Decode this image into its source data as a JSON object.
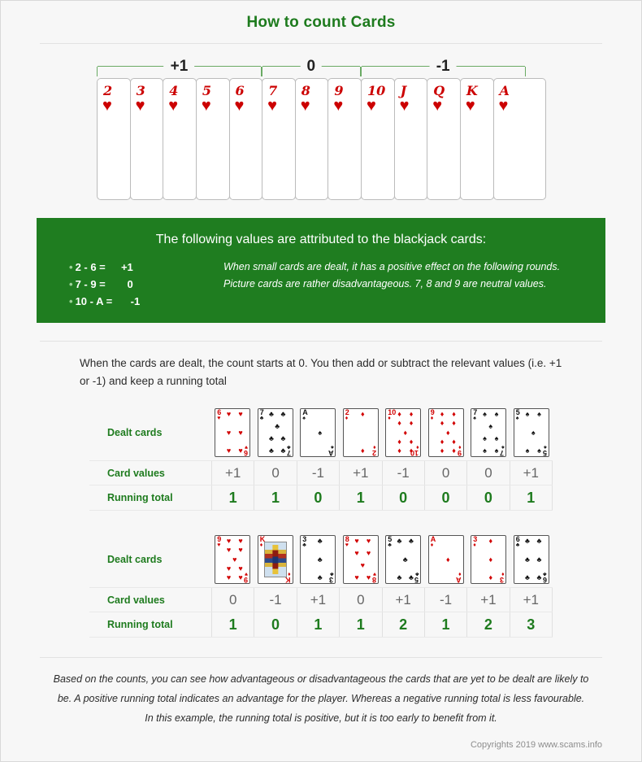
{
  "page": {
    "title": "How to count Cards",
    "copyright": "Copyrights 2019 www.scams.info",
    "accent_green": "#1e7b1e",
    "box_green": "#1f7d20",
    "card_red": "#cc0000",
    "background": "#f7f7f7"
  },
  "reference_chart": {
    "brackets": [
      {
        "label": "+1",
        "cards": "2-6"
      },
      {
        "label": "0",
        "cards": "7-9"
      },
      {
        "label": "-1",
        "cards": "10-A"
      }
    ],
    "cards": [
      {
        "rank": "2",
        "suit": "♥"
      },
      {
        "rank": "3",
        "suit": "♥"
      },
      {
        "rank": "4",
        "suit": "♥"
      },
      {
        "rank": "5",
        "suit": "♥"
      },
      {
        "rank": "6",
        "suit": "♥"
      },
      {
        "rank": "7",
        "suit": "♥"
      },
      {
        "rank": "8",
        "suit": "♥"
      },
      {
        "rank": "9",
        "suit": "♥"
      },
      {
        "rank": "10",
        "suit": "♥"
      },
      {
        "rank": "J",
        "suit": "♥"
      },
      {
        "rank": "Q",
        "suit": "♥"
      },
      {
        "rank": "K",
        "suit": "♥"
      },
      {
        "rank": "A",
        "suit": "♥"
      }
    ]
  },
  "values_box": {
    "heading": "The following values are attributed to the blackjack cards:",
    "rows": [
      {
        "range": "2 - 6 =",
        "value": "+1"
      },
      {
        "range": "7 - 9 =",
        "value": "0"
      },
      {
        "range": "10 - A =",
        "value": "-1"
      }
    ],
    "note": "When small cards are dealt, it has a positive effect on the following rounds. Picture cards are rather disadvantageous. 7, 8 and 9 are neutral values."
  },
  "intro": "When the cards are dealt, the count starts at 0. You then add or subtract the relevant values (i.e. +1 or -1) and keep a running total",
  "labels": {
    "dealt_cards": "Dealt cards",
    "card_values": "Card values",
    "running_total": "Running total"
  },
  "examples": [
    {
      "cards": [
        {
          "rank": "6",
          "suit": "♥",
          "color": "red",
          "pips": 6
        },
        {
          "rank": "7",
          "suit": "♣",
          "color": "black",
          "pips": 7
        },
        {
          "rank": "A",
          "suit": "♠",
          "color": "black",
          "pips": 1
        },
        {
          "rank": "2",
          "suit": "♦",
          "color": "red",
          "pips": 2
        },
        {
          "rank": "10",
          "suit": "♦",
          "color": "red",
          "pips": 10
        },
        {
          "rank": "9",
          "suit": "♦",
          "color": "red",
          "pips": 9
        },
        {
          "rank": "7",
          "suit": "♠",
          "color": "black",
          "pips": 7
        },
        {
          "rank": "5",
          "suit": "♠",
          "color": "black",
          "pips": 5
        }
      ],
      "card_values": [
        "+1",
        "0",
        "-1",
        "+1",
        "-1",
        "0",
        "0",
        "+1"
      ],
      "running_total": [
        "1",
        "1",
        "0",
        "1",
        "0",
        "0",
        "0",
        "1"
      ]
    },
    {
      "cards": [
        {
          "rank": "9",
          "suit": "♥",
          "color": "red",
          "pips": 9
        },
        {
          "rank": "K",
          "suit": "♦",
          "color": "red",
          "pips": 0,
          "face": true
        },
        {
          "rank": "3",
          "suit": "♣",
          "color": "black",
          "pips": 3
        },
        {
          "rank": "8",
          "suit": "♥",
          "color": "red",
          "pips": 8
        },
        {
          "rank": "5",
          "suit": "♣",
          "color": "black",
          "pips": 5
        },
        {
          "rank": "A",
          "suit": "♦",
          "color": "red",
          "pips": 1
        },
        {
          "rank": "3",
          "suit": "♦",
          "color": "red",
          "pips": 3
        },
        {
          "rank": "6",
          "suit": "♣",
          "color": "black",
          "pips": 6
        }
      ],
      "card_values": [
        "0",
        "-1",
        "+1",
        "0",
        "+1",
        "-1",
        "+1",
        "+1"
      ],
      "running_total": [
        "1",
        "0",
        "1",
        "1",
        "2",
        "1",
        "2",
        "3"
      ]
    }
  ],
  "footnote": [
    "Based on the counts, you can see how advantageous or disadvantageous the cards that are yet to be dealt are likely to",
    "be. A positive running total indicates an advantage for the player. Whereas a negative running total is less favourable.",
    "In this example, the running total is positive, but it is too early to benefit from it."
  ]
}
